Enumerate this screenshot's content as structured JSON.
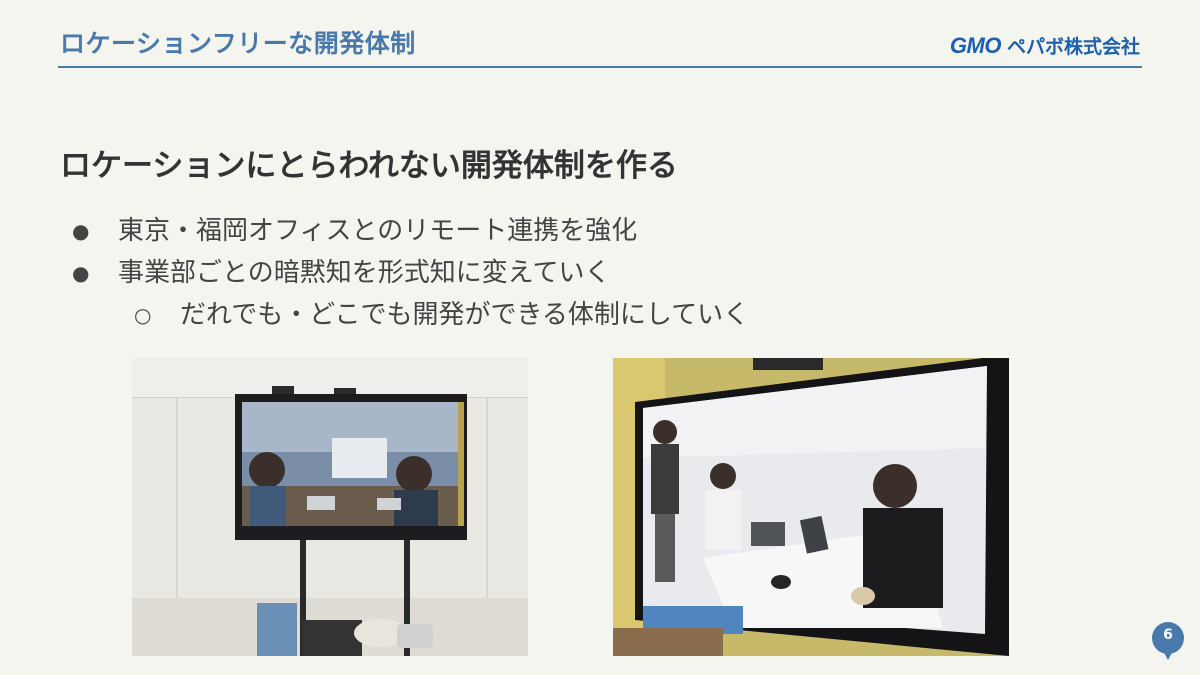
{
  "header": {
    "title": "ロケーションフリーな開発体制",
    "logo_gmo": "GMO",
    "logo_company": "ペパボ株式会社",
    "accent_color": "#4a79ad"
  },
  "heading": "ロケーションにとらわれない開発体制を作る",
  "bullets": [
    "東京・福岡オフィスとのリモート連携を強化",
    "事業部ごとの暗黙知を形式知に変えていく"
  ],
  "sub_bullets": [
    "だれでも・どこでも開発ができる体制にしていく"
  ],
  "page_number": "6"
}
